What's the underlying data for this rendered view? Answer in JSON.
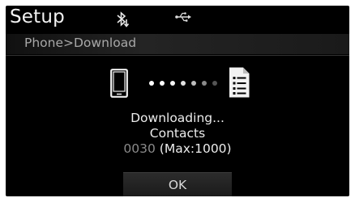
{
  "header": {
    "title": "Setup",
    "icons": [
      "bluetooth-download-icon",
      "usb-icon"
    ]
  },
  "breadcrumb": "Phone>Download",
  "download": {
    "source_icon": "phone-icon",
    "target_icon": "document-list-icon",
    "status": "Downloading...",
    "item": "Contacts",
    "count": "0030",
    "max": "(Max:1000)"
  },
  "ok_button": "OK",
  "colors": {
    "background": "#000000",
    "text": "#ececec",
    "muted": "#8a8a8a"
  }
}
